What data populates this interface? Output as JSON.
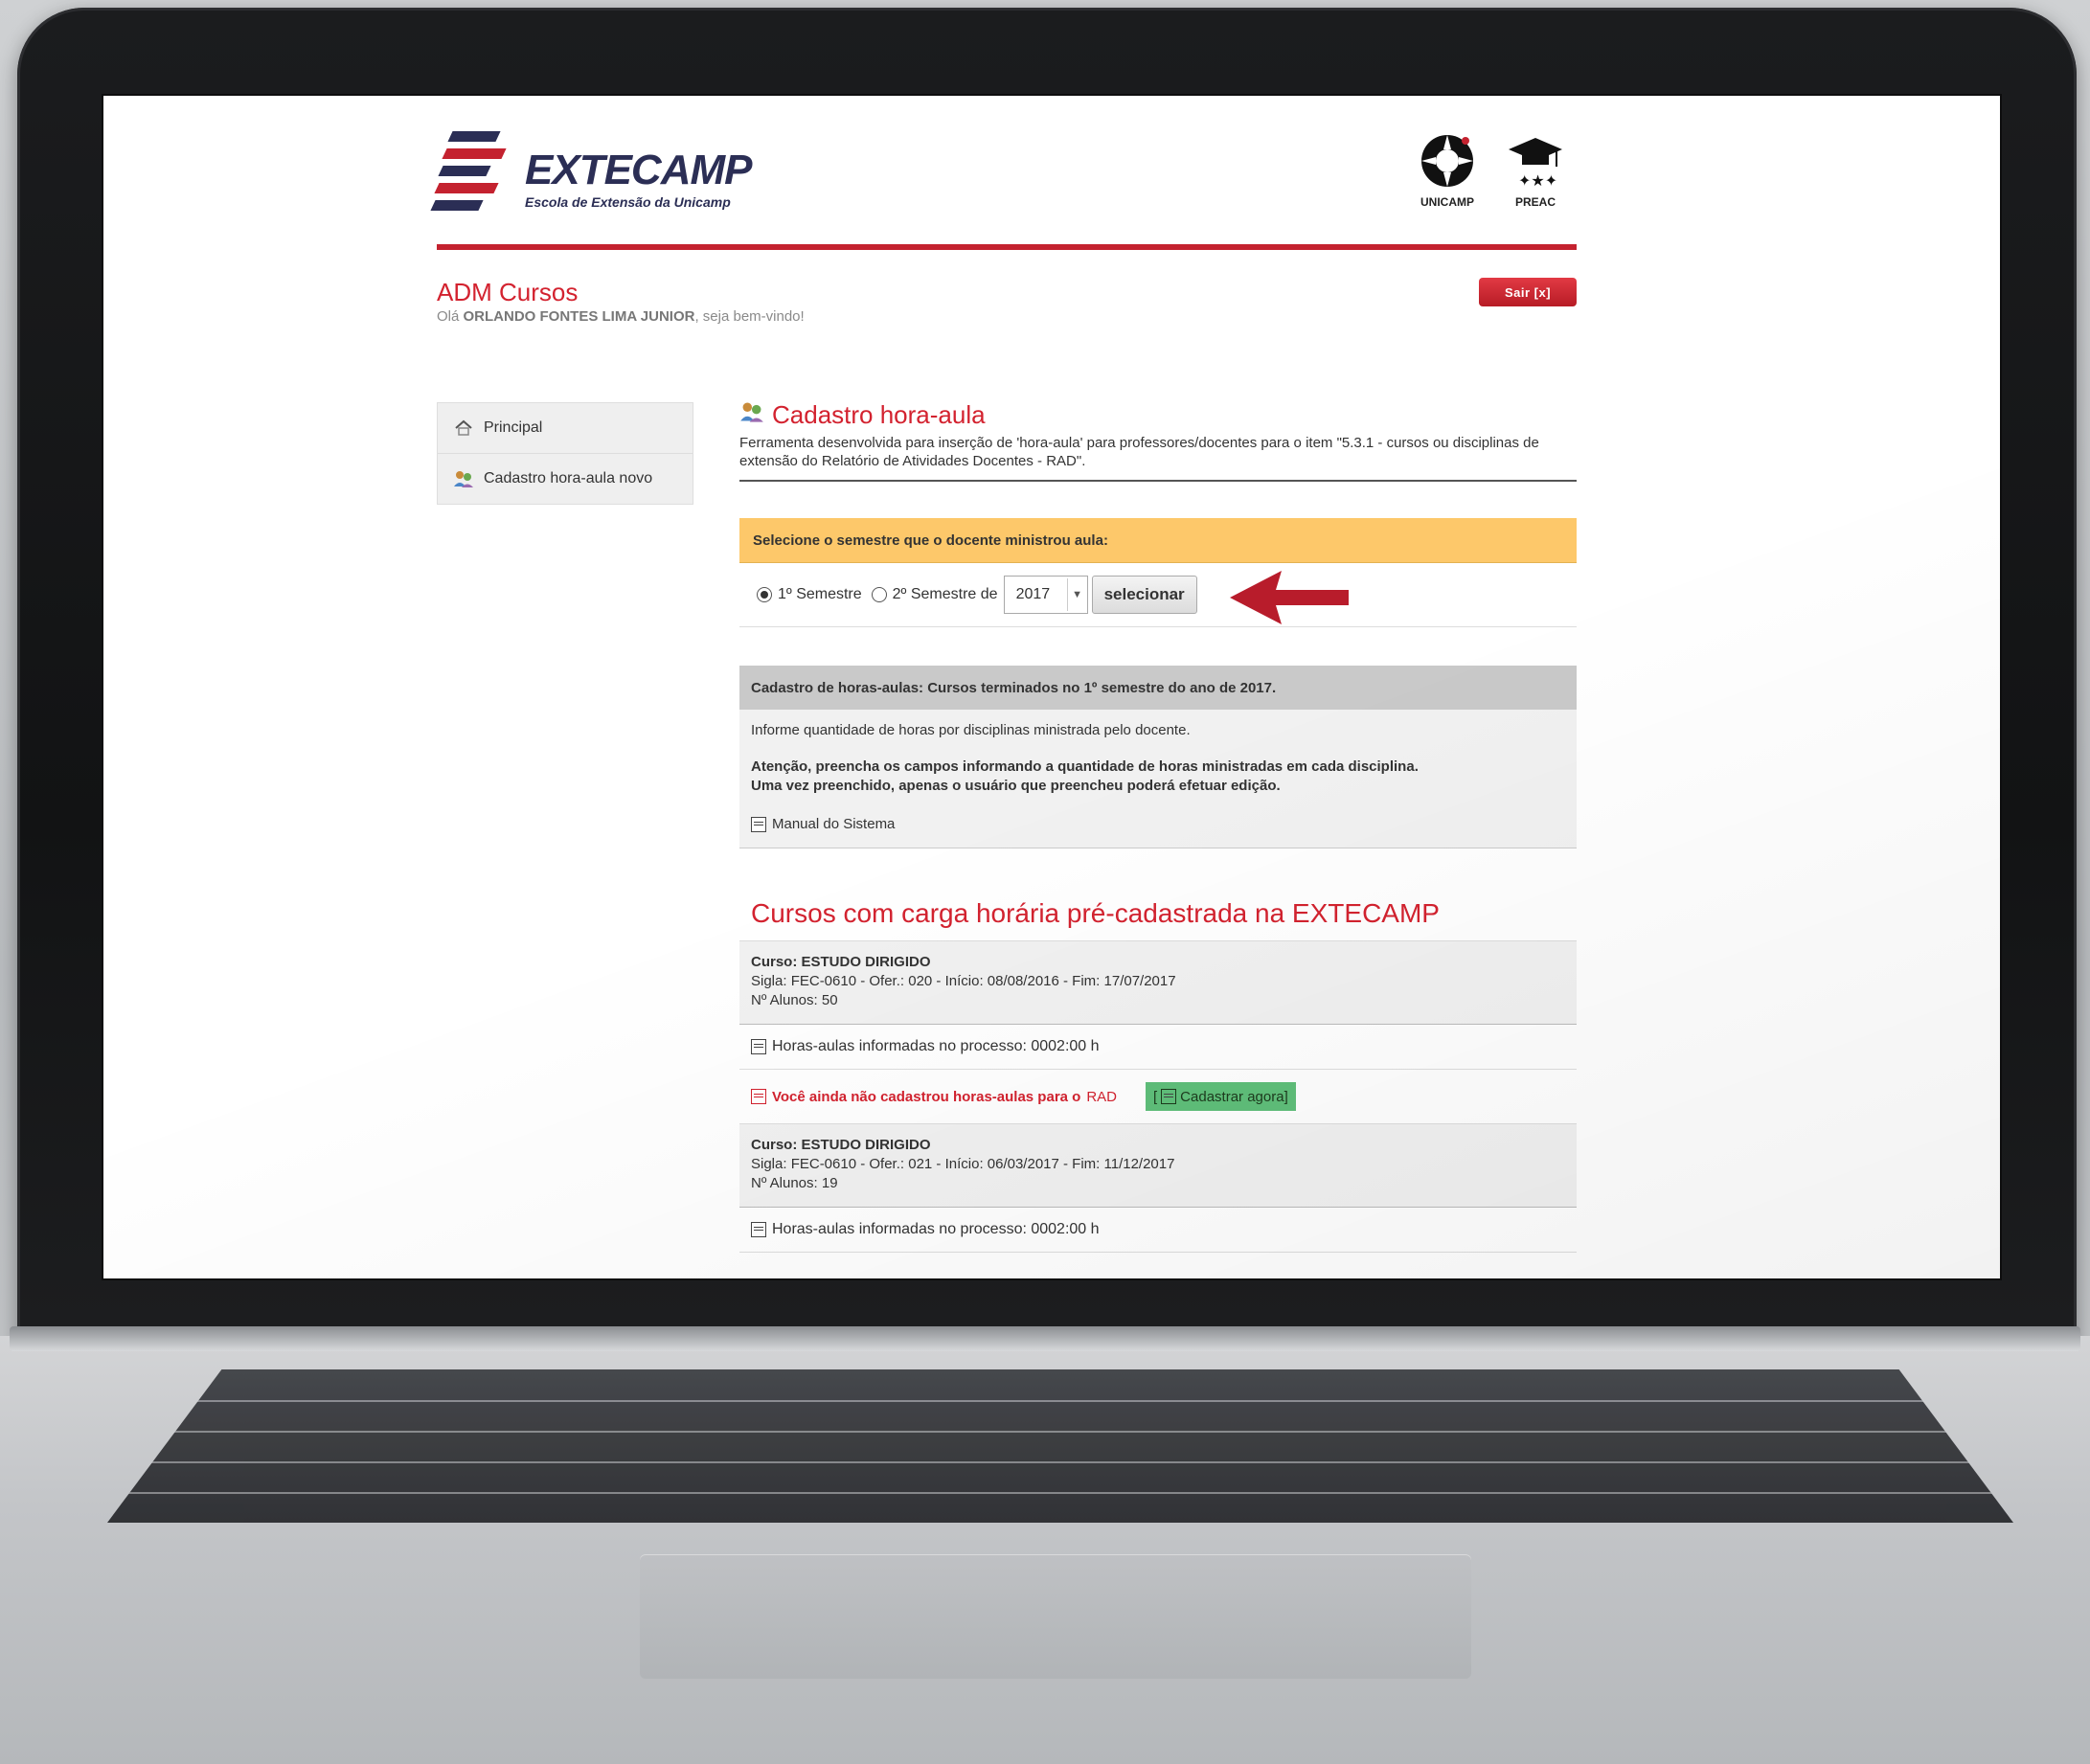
{
  "header": {
    "logo_title": "EXTECAMP",
    "logo_subtitle": "Escola de Extensão da Unicamp",
    "partner_1": "UNICAMP",
    "partner_2": "PREAC"
  },
  "account": {
    "app_title": "ADM Cursos",
    "greeting_prefix": "Olá",
    "user_name": "ORLANDO FONTES LIMA JUNIOR",
    "greeting_suffix": ", seja bem-vindo!",
    "logout_label": "Sair [x]"
  },
  "sidebar": {
    "items": [
      {
        "label": "Principal",
        "icon": "home-icon"
      },
      {
        "label": "Cadastro hora-aula novo",
        "icon": "users-icon"
      }
    ]
  },
  "main": {
    "title": "Cadastro hora-aula",
    "description": "Ferramenta desenvolvida para inserção de 'hora-aula' para professores/docentes para o item \"5.3.1 - cursos ou disciplinas de extensão do Relatório de Atividades Docentes - RAD\".",
    "select_prompt": "Selecione o semestre que o docente ministrou aula:",
    "semester_1": "1º Semestre",
    "semester_2": "2º Semestre de",
    "selected_semester": "1",
    "year": "2017",
    "select_button": "selecionar"
  },
  "info": {
    "heading": "Cadastro de horas-aulas: Cursos terminados no 1º semestre do ano de 2017.",
    "instruction": "Informe quantidade de horas por disciplinas ministrada pelo docente.",
    "warning_line1": "Atenção, preencha os campos informando a quantidade de horas ministradas em cada disciplina.",
    "warning_line2": "Uma vez preenchido, apenas o usuário que preencheu poderá efetuar edição.",
    "manual_link": "Manual do Sistema"
  },
  "courses": {
    "title": "Cursos com carga horária pré-cadastrada na EXTECAMP",
    "items": [
      {
        "name": "Curso: ESTUDO DIRIGIDO",
        "details": "Sigla: FEC-0610 - Ofer.: 020 - Início: 08/08/2016 - Fim: 17/07/2017",
        "students": "Nº Alunos: 50",
        "hours": "Horas-aulas informadas no processo: 0002:00 h",
        "warning": "Você ainda não cadastrou horas-aulas para o",
        "warning_tag": "RAD",
        "action_open": "[",
        "action_label": "Cadastrar agora]"
      },
      {
        "name": "Curso: ESTUDO DIRIGIDO",
        "details": "Sigla: FEC-0610 - Ofer.: 021 - Início: 06/03/2017 - Fim: 11/12/2017",
        "students": "Nº Alunos: 19",
        "hours": "Horas-aulas informadas no processo: 0002:00 h"
      }
    ]
  },
  "colors": {
    "brand_red": "#d3222f",
    "brand_navy": "#2b2e55",
    "prompt_bar": "#fdc86a",
    "action_green": "#5fbf7a"
  }
}
